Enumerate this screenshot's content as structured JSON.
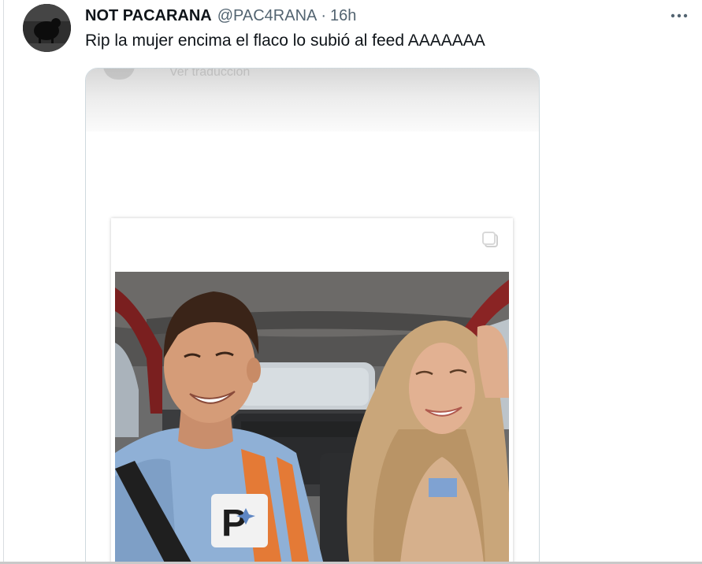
{
  "tweet": {
    "display_name": "NOT PACARANA",
    "handle": "@PAC4RANA",
    "separator": "·",
    "timestamp": "16h",
    "text": "Rip la mujer encima el flaco lo subió al feed AAAAAAA",
    "more_label": "•••"
  },
  "media": {
    "ghost_caption": "Ver traducción"
  },
  "colors": {
    "primary_text": "#0f1419",
    "secondary_text": "#536471",
    "border": "#cfd9de"
  }
}
